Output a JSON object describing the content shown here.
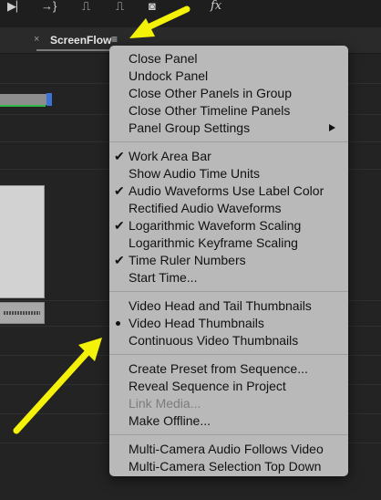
{
  "toolbar": {
    "icons": [
      {
        "name": "step-forward-icon",
        "glyph": "▶⎸"
      },
      {
        "name": "go-to-next-edit-icon",
        "glyph": "→}"
      },
      {
        "name": "lift-icon",
        "glyph": "⎍"
      },
      {
        "name": "extract-icon",
        "glyph": "⎍"
      },
      {
        "name": "camera-icon",
        "glyph": "◙"
      },
      {
        "name": "fx-icon",
        "glyph": "fx"
      }
    ]
  },
  "tab": {
    "close_glyph": "×",
    "label": "ScreenFlow",
    "menu_glyph": "≡"
  },
  "menu": {
    "groups": [
      {
        "items": [
          {
            "label": "Close Panel",
            "check": false,
            "bullet": false,
            "submenu": false,
            "disabled": false
          },
          {
            "label": "Undock Panel",
            "check": false,
            "bullet": false,
            "submenu": false,
            "disabled": false
          },
          {
            "label": "Close Other Panels in Group",
            "check": false,
            "bullet": false,
            "submenu": false,
            "disabled": false
          },
          {
            "label": "Close Other Timeline Panels",
            "check": false,
            "bullet": false,
            "submenu": false,
            "disabled": false
          },
          {
            "label": "Panel Group Settings",
            "check": false,
            "bullet": false,
            "submenu": true,
            "disabled": false
          }
        ]
      },
      {
        "items": [
          {
            "label": "Work Area Bar",
            "check": true,
            "bullet": false,
            "submenu": false,
            "disabled": false
          },
          {
            "label": "Show Audio Time Units",
            "check": false,
            "bullet": false,
            "submenu": false,
            "disabled": false
          },
          {
            "label": "Audio Waveforms Use Label Color",
            "check": true,
            "bullet": false,
            "submenu": false,
            "disabled": false
          },
          {
            "label": "Rectified Audio Waveforms",
            "check": false,
            "bullet": false,
            "submenu": false,
            "disabled": false
          },
          {
            "label": "Logarithmic Waveform Scaling",
            "check": true,
            "bullet": false,
            "submenu": false,
            "disabled": false
          },
          {
            "label": "Logarithmic Keyframe Scaling",
            "check": false,
            "bullet": false,
            "submenu": false,
            "disabled": false
          },
          {
            "label": "Time Ruler Numbers",
            "check": true,
            "bullet": false,
            "submenu": false,
            "disabled": false
          },
          {
            "label": "Start Time...",
            "check": false,
            "bullet": false,
            "submenu": false,
            "disabled": false
          }
        ]
      },
      {
        "items": [
          {
            "label": "Video Head and Tail Thumbnails",
            "check": false,
            "bullet": false,
            "submenu": false,
            "disabled": false
          },
          {
            "label": "Video Head Thumbnails",
            "check": false,
            "bullet": true,
            "submenu": false,
            "disabled": false
          },
          {
            "label": "Continuous Video Thumbnails",
            "check": false,
            "bullet": false,
            "submenu": false,
            "disabled": false
          }
        ]
      },
      {
        "items": [
          {
            "label": "Create Preset from Sequence...",
            "check": false,
            "bullet": false,
            "submenu": false,
            "disabled": false
          },
          {
            "label": "Reveal Sequence in Project",
            "check": false,
            "bullet": false,
            "submenu": false,
            "disabled": false
          },
          {
            "label": "Link Media...",
            "check": false,
            "bullet": false,
            "submenu": false,
            "disabled": true
          },
          {
            "label": "Make Offline...",
            "check": false,
            "bullet": false,
            "submenu": false,
            "disabled": false
          }
        ]
      },
      {
        "items": [
          {
            "label": "Multi-Camera Audio Follows Video",
            "check": false,
            "bullet": false,
            "submenu": false,
            "disabled": false
          },
          {
            "label": "Multi-Camera Selection Top Down",
            "check": false,
            "bullet": false,
            "submenu": false,
            "disabled": false
          }
        ]
      }
    ]
  },
  "colors": {
    "annotation_arrow": "#f5f20a",
    "menu_background": "#b9b9b9",
    "app_background": "#232323",
    "work_area_green": "#2fb84a",
    "work_area_handle": "#3a72d6"
  }
}
